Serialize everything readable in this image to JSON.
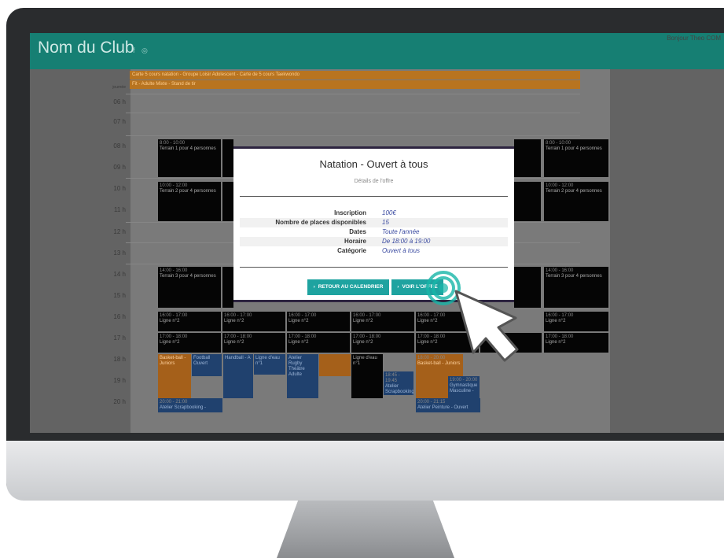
{
  "header": {
    "club_name": "Nom du Club",
    "social_facebook": "f",
    "social_instagram": "◎",
    "user_name": "Bonjour Theo COM"
  },
  "calendar": {
    "allday_label": "journée",
    "allday_events": [
      "Carte 5 cours natation - Groupe Loisir Adolescent - Carte de 5 cours Taekwondo",
      "Fit - Adulte Mixte - Stand de tir"
    ],
    "hours": [
      "06 h",
      "07 h",
      "08 h",
      "09 h",
      "10 h",
      "11 h",
      "12 h",
      "13 h",
      "14 h",
      "15 h",
      "16 h",
      "17 h",
      "18 h",
      "19 h",
      "20 h"
    ],
    "events": {
      "t1_time": "8:00 - 10:00",
      "t1_label": "Terrain 1 pour 4 personnes",
      "t2_time": "10:00 - 12:00",
      "t2_label": "Terrain 2 pour 4 personnes",
      "t3_time": "14:00 - 16:00",
      "t3_label": "Terrain 3 pour 4 personnes",
      "l2a_time": "16:00 - 17:00",
      "l2a_label": "Ligne n°2",
      "l2b_time": "17:00 - 18:00",
      "l2b_label": "Ligne n°2",
      "basket_time": "18:00 - 20:00",
      "basket_label": "Basket-ball - Juniors",
      "foot_label": "Football Ouvert",
      "handball_label": "Handball - A",
      "ligne1_label": "Ligne d'eau n°1",
      "rugby_label": "Atelier Rugby Théâtre Adulte",
      "scrap_time": "20:00 - 21:00",
      "scrap_label": "Atelier Scrapbooking -",
      "scrap2_time": "18:45 - 19:45",
      "scrap2_label": "Atelier Scrapbooking",
      "peinture_time": "20:00 - 21:15",
      "peinture_label": "Atelier Peinture - Ouvert",
      "gym_time": "19:00 - 20:00",
      "gym_label": "Gymnastique Masculine -"
    }
  },
  "modal": {
    "title": "Natation - Ouvert à tous",
    "subtitle": "Détails de l'offre",
    "rows": [
      {
        "key": "Inscription",
        "value": "100€"
      },
      {
        "key": "Nombre de places disponibles",
        "value": "15"
      },
      {
        "key": "Dates",
        "value": "Toute l'année"
      },
      {
        "key": "Horaire",
        "value": "De 18:00 à 19:00"
      },
      {
        "key": "Catégorie",
        "value": "Ouvert à tous"
      }
    ],
    "back_button": "RETOUR AU CALENDRIER",
    "view_button": "VOIR L'OFFRE"
  },
  "colors": {
    "header": "#167f73",
    "button": "#1ea3a0",
    "event": "#050505",
    "event_blue": "#20416e",
    "event_orange": "#a5601a",
    "cursor_highlight": "#16b5a8"
  },
  "icons": {
    "cursor": "hand-pointer-click-icon",
    "button_chevron": "chevron-right-icon"
  }
}
